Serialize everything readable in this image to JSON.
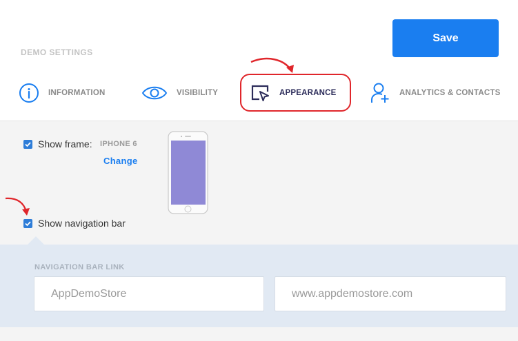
{
  "header": {
    "section_title": "DEMO SETTINGS",
    "save_label": "Save"
  },
  "tabs": [
    {
      "label": "INFORMATION",
      "icon": "info-icon",
      "active": false
    },
    {
      "label": "VISIBILITY",
      "icon": "eye-icon",
      "active": false
    },
    {
      "label": "APPEARANCE",
      "icon": "cursor-window-icon",
      "active": true
    },
    {
      "label": "ANALYTICS & CONTACTS",
      "icon": "add-user-icon",
      "active": false
    }
  ],
  "appearance": {
    "show_frame_label": "Show frame:",
    "show_frame_checked": true,
    "frame_model": "IPHONE 6",
    "change_label": "Change",
    "show_navbar_label": "Show navigation bar",
    "show_navbar_checked": true,
    "screen_color": "#8f89d6"
  },
  "navigation_bar_link": {
    "heading": "NAVIGATION BAR LINK",
    "name_placeholder": "AppDemoStore",
    "url_placeholder": "www.appdemostore.com"
  },
  "colors": {
    "accent": "#1a7ef0",
    "annotation": "#e0262b"
  }
}
